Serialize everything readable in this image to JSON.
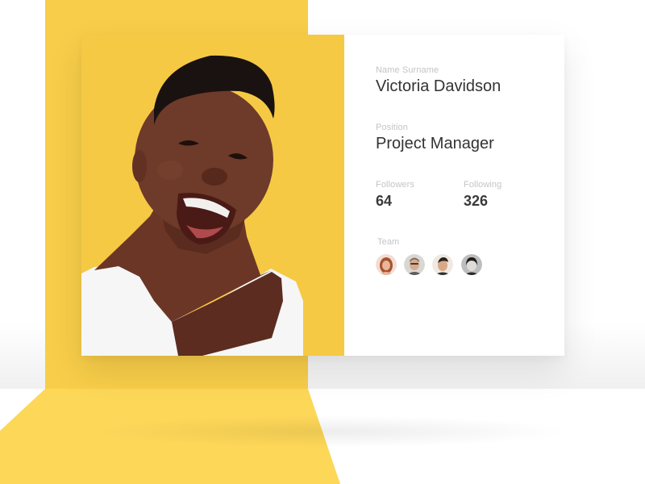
{
  "profile": {
    "name_label": "Name Surname",
    "name": "Victoria Davidson",
    "position_label": "Position",
    "position": "Project Manager",
    "followers_label": "Followers",
    "followers": "64",
    "following_label": "Following",
    "following": "326",
    "team_label": "Team"
  },
  "team": [
    {
      "name": "team-member-1",
      "skin": "#e8b79a",
      "hair": "#a8522f",
      "bg": "#f1ddd2"
    },
    {
      "name": "team-member-2",
      "skin": "#d8ab8d",
      "hair": "#7e6b5c",
      "bg": "#d9d7d3"
    },
    {
      "name": "team-member-3",
      "skin": "#d9a987",
      "hair": "#2a2220",
      "bg": "#efe9e2"
    },
    {
      "name": "team-member-4",
      "skin": "#dedbd8",
      "hair": "#1d1d1d",
      "bg": "#bdbdbd"
    }
  ],
  "colors": {
    "accent_yellow": "#f8cd49",
    "photo_background": "#f5c944",
    "label_gray": "#c4c4c4",
    "text_dark": "#333333"
  }
}
